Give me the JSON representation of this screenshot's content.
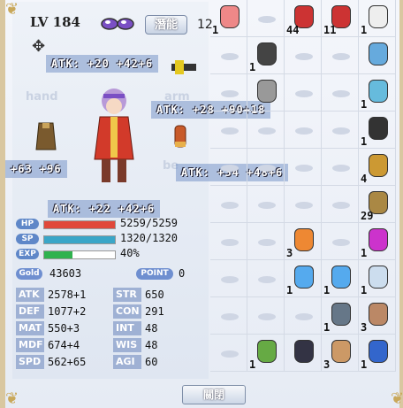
{
  "character": {
    "level": "LV 184",
    "skill_button": "潛能",
    "skill_points": "12",
    "slot_hand": "hand",
    "slot_arm": "arm",
    "slot_be": "be"
  },
  "atk_tags": [
    "ATK: +20 +42+6",
    "ATK: +28 +90+18",
    "+63 +96",
    "ATK: +34 +48+6",
    "ATK: +22 +42+6"
  ],
  "bars": {
    "hp_label": "HP",
    "hp_text": "5259/5259",
    "hp_fraction": 1.0,
    "hp_color": "#e0483a",
    "sp_label": "SP",
    "sp_text": "1320/1320",
    "sp_fraction": 1.0,
    "sp_color": "#3aa6c8",
    "exp_label": "EXP",
    "exp_text": "40%",
    "exp_fraction": 0.4,
    "exp_color": "#2fb24e"
  },
  "gold": {
    "label": "Gold",
    "value": "43603",
    "point_label": "POINT",
    "point_value": "0"
  },
  "stats": [
    {
      "k1": "ATK",
      "v1": "2578+1",
      "k2": "STR",
      "v2": "650"
    },
    {
      "k1": "DEF",
      "v1": "1077+2",
      "k2": "CON",
      "v2": "291"
    },
    {
      "k1": "MAT",
      "v1": "550+3",
      "k2": "INT",
      "v2": "48"
    },
    {
      "k1": "MDF",
      "v1": "674+4",
      "k2": "WIS",
      "v2": "48"
    },
    {
      "k1": "SPD",
      "v1": "562+65",
      "k2": "AGI",
      "v2": "60"
    }
  ],
  "inventory": [
    {
      "count": "1",
      "icon": "pink-potion-icon",
      "color": "#e88"
    },
    {
      "count": "",
      "icon": "",
      "color": ""
    },
    {
      "count": "44",
      "icon": "red-feather-icon",
      "color": "#c33"
    },
    {
      "count": "11",
      "icon": "red-feather-icon",
      "color": "#c33"
    },
    {
      "count": "1",
      "icon": "white-flask-icon",
      "color": "#eee"
    },
    {
      "count": "",
      "icon": "",
      "color": ""
    },
    {
      "count": "1",
      "icon": "walkie-talkie-icon",
      "color": "#444"
    },
    {
      "count": "",
      "icon": "",
      "color": ""
    },
    {
      "count": "",
      "icon": "",
      "color": ""
    },
    {
      "count": "",
      "icon": "blue-scroll-icon",
      "color": "#6ad"
    },
    {
      "count": "",
      "icon": "",
      "color": ""
    },
    {
      "count": "",
      "icon": "gear-coin-icon",
      "color": "#999"
    },
    {
      "count": "",
      "icon": "",
      "color": ""
    },
    {
      "count": "",
      "icon": "",
      "color": ""
    },
    {
      "count": "1",
      "icon": "blue-potion-icon",
      "color": "#6bd"
    },
    {
      "count": "",
      "icon": "",
      "color": ""
    },
    {
      "count": "",
      "icon": "",
      "color": ""
    },
    {
      "count": "",
      "icon": "",
      "color": ""
    },
    {
      "count": "",
      "icon": "",
      "color": ""
    },
    {
      "count": "1",
      "icon": "frying-pan-icon",
      "color": "#333"
    },
    {
      "count": "",
      "icon": "",
      "color": ""
    },
    {
      "count": "",
      "icon": "",
      "color": ""
    },
    {
      "count": "",
      "icon": "",
      "color": ""
    },
    {
      "count": "",
      "icon": "",
      "color": ""
    },
    {
      "count": "4",
      "icon": "gold-coins-icon",
      "color": "#c93"
    },
    {
      "count": "",
      "icon": "",
      "color": ""
    },
    {
      "count": "",
      "icon": "",
      "color": ""
    },
    {
      "count": "",
      "icon": "",
      "color": ""
    },
    {
      "count": "",
      "icon": "",
      "color": ""
    },
    {
      "count": "29",
      "icon": "wood-cross-icon",
      "color": "#a84"
    },
    {
      "count": "",
      "icon": "",
      "color": ""
    },
    {
      "count": "",
      "icon": "",
      "color": ""
    },
    {
      "count": "3",
      "icon": "orange-potion-icon",
      "color": "#e83"
    },
    {
      "count": "",
      "icon": "",
      "color": ""
    },
    {
      "count": "1",
      "icon": "purple-potion-icon",
      "color": "#c3c"
    },
    {
      "count": "",
      "icon": "",
      "color": ""
    },
    {
      "count": "",
      "icon": "",
      "color": ""
    },
    {
      "count": "1",
      "icon": "blue-potion-pair-icon",
      "color": "#5ae"
    },
    {
      "count": "1",
      "icon": "blue-potion-pair-icon",
      "color": "#5ae"
    },
    {
      "count": "1",
      "icon": "white-flask-icon",
      "color": "#cde"
    },
    {
      "count": "",
      "icon": "",
      "color": ""
    },
    {
      "count": "",
      "icon": "",
      "color": ""
    },
    {
      "count": "",
      "icon": "",
      "color": ""
    },
    {
      "count": "1",
      "icon": "tent-icon",
      "color": "#678"
    },
    {
      "count": "3",
      "icon": "bear-doll-icon",
      "color": "#b86"
    },
    {
      "count": "",
      "icon": "",
      "color": ""
    },
    {
      "count": "1",
      "icon": "green-lantern-icon",
      "color": "#6a4"
    },
    {
      "count": "",
      "icon": "remote-icon",
      "color": "#334"
    },
    {
      "count": "3",
      "icon": "noodle-bowl-icon",
      "color": "#c96"
    },
    {
      "count": "1",
      "icon": "blue-cart-icon",
      "color": "#36c"
    }
  ],
  "close_button": "關閉"
}
